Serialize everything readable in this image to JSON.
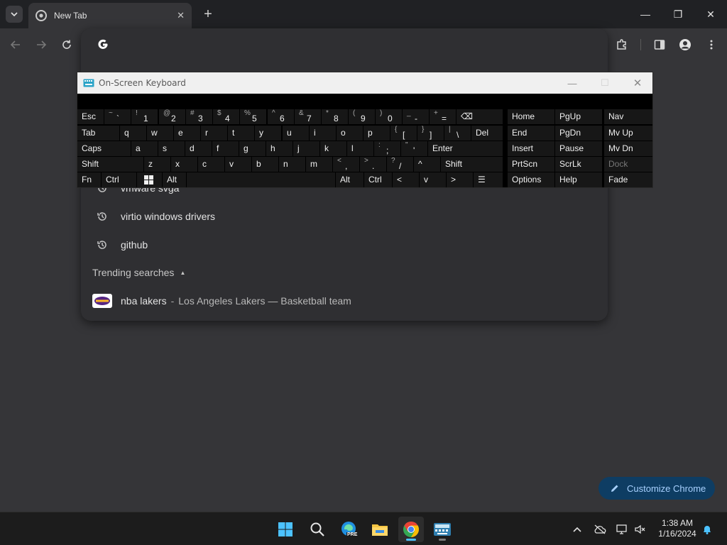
{
  "browser": {
    "tab_title": "New Tab",
    "tab_close": "✕",
    "new_tab": "+",
    "window_controls": [
      "—",
      "❐",
      "✕"
    ]
  },
  "omnibox": {
    "suggestions": [
      "vmware svga",
      "virtio windows drivers",
      "github"
    ],
    "trending_header": "Trending searches",
    "trending": {
      "query": "nba lakers",
      "separator": "-",
      "description": "Los Angeles Lakers — Basketball team"
    }
  },
  "osk": {
    "title": "On-Screen Keyboard",
    "window_controls": [
      "—",
      "☐",
      "✕"
    ],
    "rows": [
      [
        {
          "id": "esc",
          "label": "Esc"
        },
        {
          "id": "tilde",
          "shift": "~",
          "main": "`"
        },
        {
          "id": "1",
          "shift": "!",
          "main": "1"
        },
        {
          "id": "2",
          "shift": "@",
          "main": "2"
        },
        {
          "id": "3",
          "shift": "#",
          "main": "3"
        },
        {
          "id": "4",
          "shift": "$",
          "main": "4"
        },
        {
          "id": "5",
          "shift": "%",
          "main": "5"
        },
        {
          "id": "6",
          "shift": "^",
          "main": "6"
        },
        {
          "id": "7",
          "shift": "&",
          "main": "7"
        },
        {
          "id": "8",
          "shift": "*",
          "main": "8"
        },
        {
          "id": "9",
          "shift": "(",
          "main": "9"
        },
        {
          "id": "0",
          "shift": ")",
          "main": "0"
        },
        {
          "id": "minus",
          "shift": "_",
          "main": "-"
        },
        {
          "id": "equals",
          "shift": "+",
          "main": "="
        },
        {
          "id": "backspace",
          "label": "⌫"
        }
      ],
      [
        {
          "id": "tab",
          "label": "Tab"
        },
        {
          "id": "q",
          "label": "q"
        },
        {
          "id": "w",
          "label": "w"
        },
        {
          "id": "e",
          "label": "e"
        },
        {
          "id": "r",
          "label": "r"
        },
        {
          "id": "t",
          "label": "t"
        },
        {
          "id": "y",
          "label": "y"
        },
        {
          "id": "u",
          "label": "u"
        },
        {
          "id": "i",
          "label": "i"
        },
        {
          "id": "o",
          "label": "o"
        },
        {
          "id": "p",
          "label": "p"
        },
        {
          "id": "lbracket",
          "shift": "{",
          "main": "["
        },
        {
          "id": "rbracket",
          "shift": "}",
          "main": "]"
        },
        {
          "id": "backslash",
          "shift": "|",
          "main": "\\"
        },
        {
          "id": "del",
          "label": "Del"
        }
      ],
      [
        {
          "id": "caps",
          "label": "Caps"
        },
        {
          "id": "a",
          "label": "a"
        },
        {
          "id": "s",
          "label": "s"
        },
        {
          "id": "d",
          "label": "d"
        },
        {
          "id": "f",
          "label": "f"
        },
        {
          "id": "g",
          "label": "g"
        },
        {
          "id": "h",
          "label": "h"
        },
        {
          "id": "j",
          "label": "j"
        },
        {
          "id": "k",
          "label": "k"
        },
        {
          "id": "l",
          "label": "l"
        },
        {
          "id": "semicolon",
          "shift": ":",
          "main": ";"
        },
        {
          "id": "quote",
          "shift": "\"",
          "main": "'"
        },
        {
          "id": "enter",
          "label": "Enter"
        }
      ],
      [
        {
          "id": "lshift",
          "label": "Shift"
        },
        {
          "id": "z",
          "label": "z"
        },
        {
          "id": "x",
          "label": "x"
        },
        {
          "id": "c",
          "label": "c"
        },
        {
          "id": "v",
          "label": "v"
        },
        {
          "id": "b",
          "label": "b"
        },
        {
          "id": "n",
          "label": "n"
        },
        {
          "id": "m",
          "label": "m"
        },
        {
          "id": "comma",
          "shift": "<",
          "main": ","
        },
        {
          "id": "period",
          "shift": ">",
          "main": "."
        },
        {
          "id": "slash",
          "shift": "?",
          "main": "/"
        },
        {
          "id": "up",
          "label": "^"
        },
        {
          "id": "rshift",
          "label": "Shift"
        }
      ],
      [
        {
          "id": "fn",
          "label": "Fn"
        },
        {
          "id": "lctrl",
          "label": "Ctrl"
        },
        {
          "id": "win",
          "label": ""
        },
        {
          "id": "lalt",
          "label": "Alt"
        },
        {
          "id": "space",
          "label": ""
        },
        {
          "id": "ralt",
          "label": "Alt"
        },
        {
          "id": "rctrl",
          "label": "Ctrl"
        },
        {
          "id": "left",
          "label": "<"
        },
        {
          "id": "down",
          "label": "v"
        },
        {
          "id": "right",
          "label": ">"
        },
        {
          "id": "menu",
          "label": "☰"
        }
      ]
    ],
    "nav_keys": [
      [
        "Home",
        "PgUp",
        "Nav"
      ],
      [
        "End",
        "PgDn",
        "Mv Up"
      ],
      [
        "Insert",
        "Pause",
        "Mv Dn"
      ],
      [
        "PrtScn",
        "ScrLk",
        "Dock"
      ],
      [
        "Options",
        "Help",
        "Fade"
      ]
    ]
  },
  "customize": {
    "label": "Customize Chrome"
  },
  "taskbar": {
    "time": "1:38 AM",
    "date": "1/16/2024",
    "edge_badge": "PRE"
  },
  "colors": {
    "accent": "#4cc2ff",
    "customize_bg": "#0e3d63"
  }
}
